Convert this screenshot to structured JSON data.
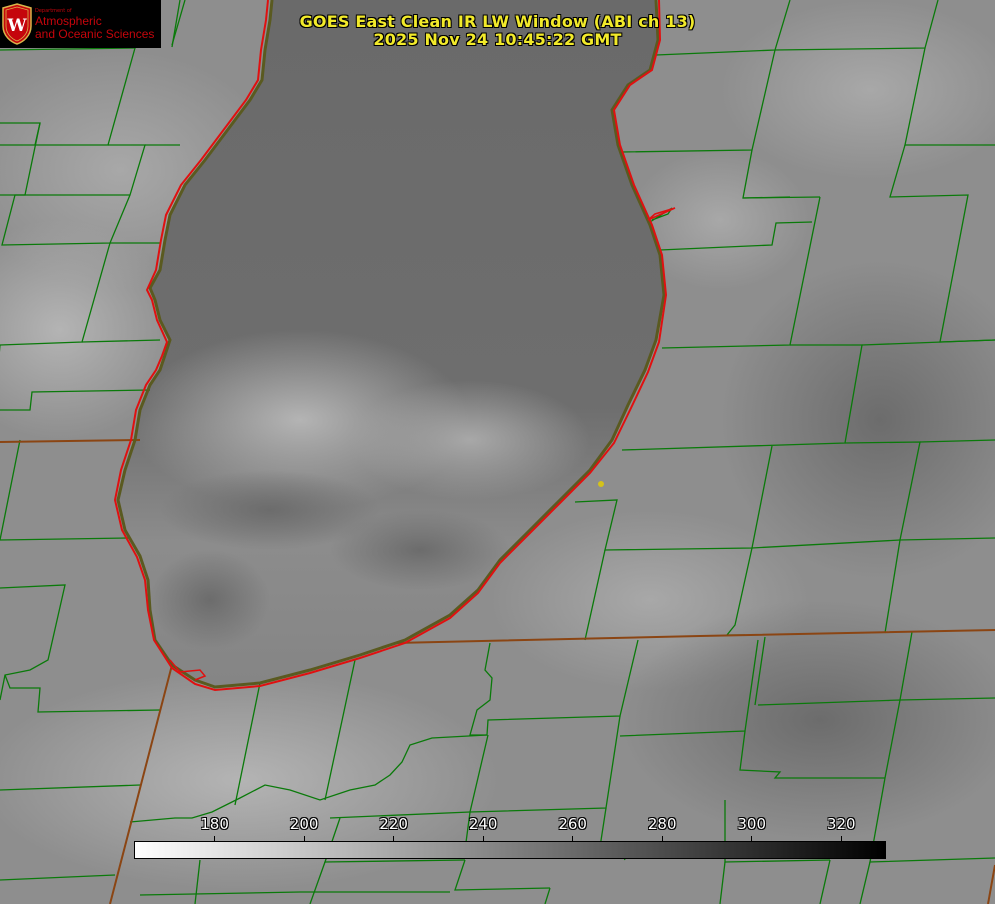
{
  "title": {
    "line1": "GOES East Clean IR LW Window (ABI ch 13)",
    "line2": "2025 Nov 24 10:45:22 GMT"
  },
  "logo": {
    "dept": "Department of",
    "line1": "Atmospheric",
    "line2": "and Oceanic Sciences",
    "seal_letter": "W"
  },
  "colorbar": {
    "ticks": [
      "180",
      "200",
      "220",
      "240",
      "260",
      "280",
      "300",
      "320"
    ],
    "tick_values": [
      180,
      200,
      220,
      240,
      260,
      280,
      300,
      320
    ],
    "range": [
      162,
      330
    ],
    "gradient": [
      "#ffffff",
      "#000000"
    ]
  },
  "colors": {
    "title_text": "#f2ea2a",
    "county_lines": "#0a7a0a",
    "state_lines": "#8b4513",
    "shoreline": "#e01010",
    "logo_red": "#c5050c",
    "station_marker": "#d4c21a"
  }
}
